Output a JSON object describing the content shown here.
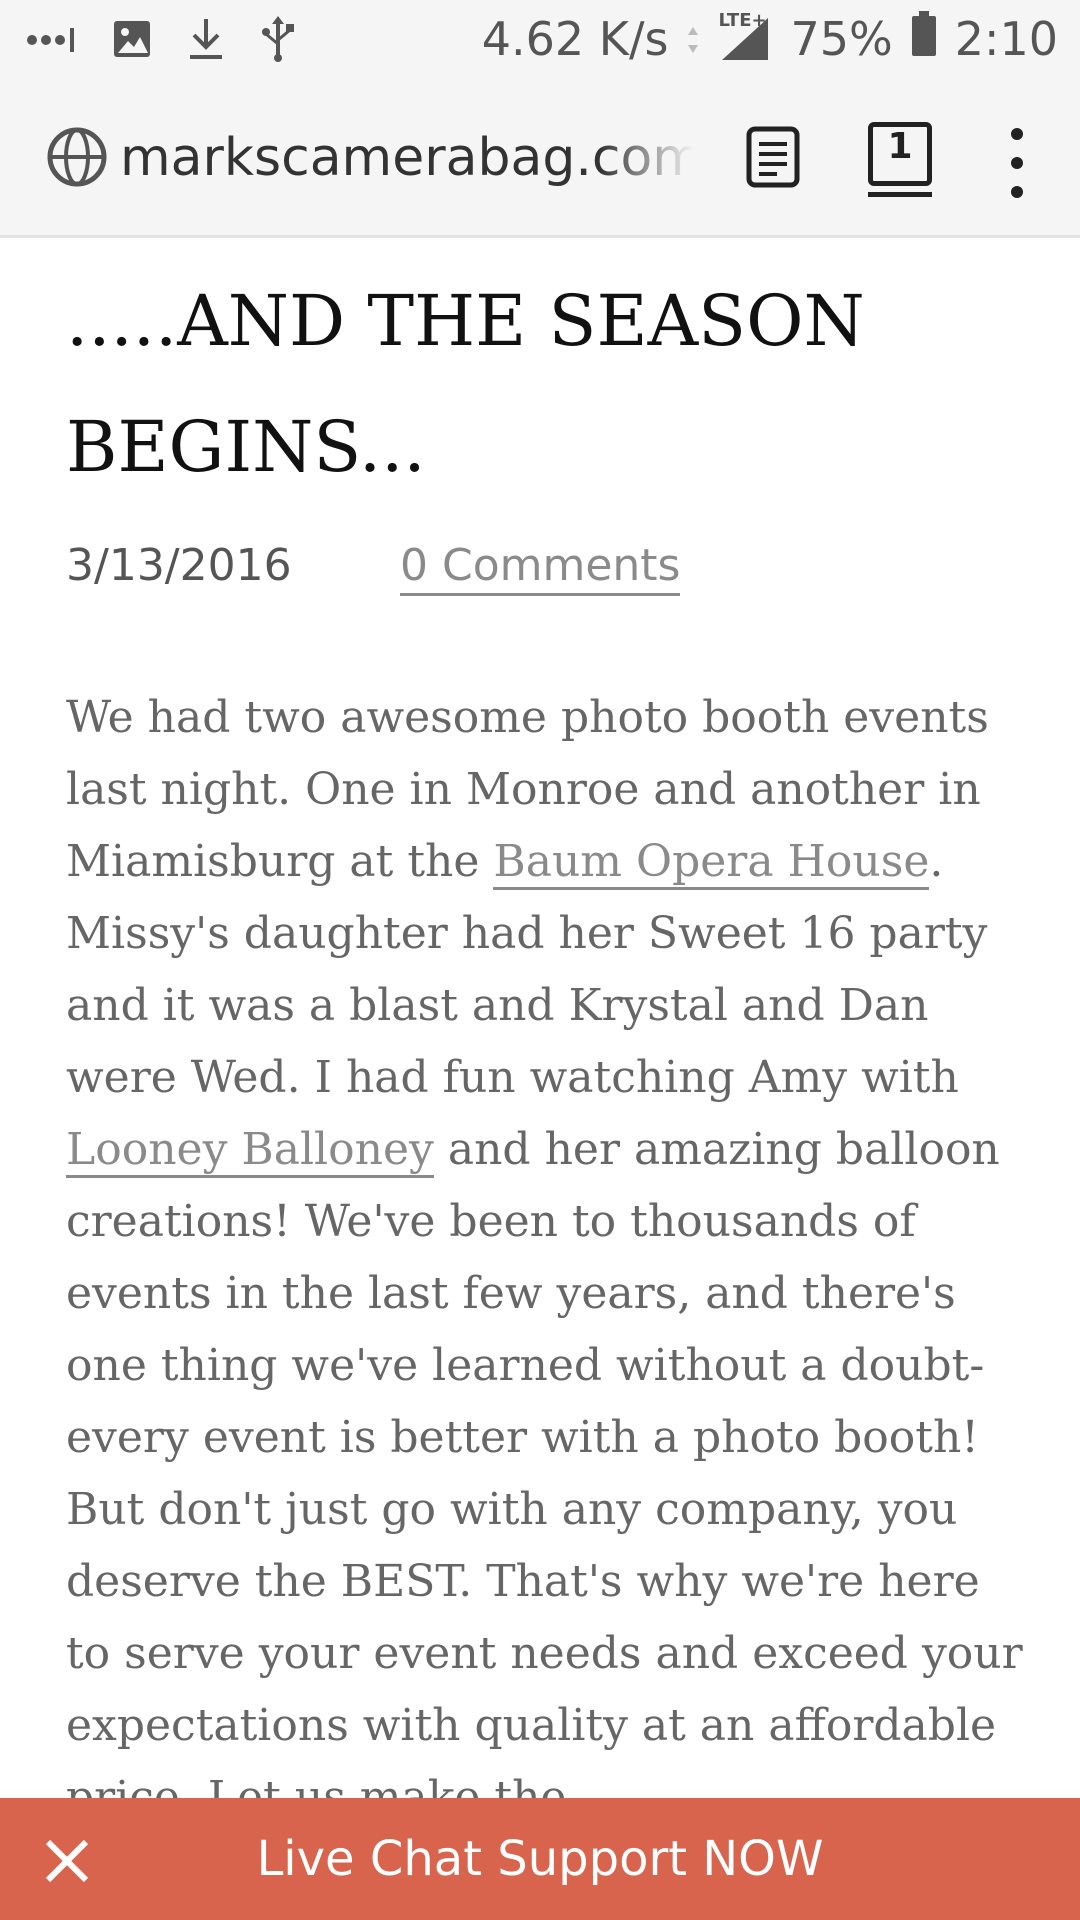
{
  "status_bar": {
    "icons": [
      "signal-dots-icon",
      "image-icon",
      "download-icon",
      "usb-icon"
    ],
    "net_speed": "4.62 K/s",
    "network": "LTE+",
    "battery": "75%",
    "time": "2:10"
  },
  "browser": {
    "url": "markscamerabag.com/b",
    "tab_count": "1",
    "icons": [
      "globe-icon",
      "reader-mode-icon",
      "tab-switcher-icon",
      "overflow-menu-icon"
    ]
  },
  "article": {
    "title_line1": ".....AND THE SEASON",
    "title_line2": "BEGINS...",
    "date": "3/13/2016",
    "comments_link": "0 Comments",
    "para_1": "We had two awesome photo booth events last night. One in Monroe and another in Miamisburg at the",
    "link_1": "Baum Opera House",
    "para_2": ". Missy's daughter had her Sweet 16 party and it was a blast and Krystal and Dan were Wed. I had fun watching Amy with",
    "link_2": "Looney Balloney",
    "para_3": "and her amazing balloon creations! We've been to thousands of events in the last few years, and there's one thing we've learned without a doubt- every event is better with a photo booth! But don't just go with any company, you deserve the BEST. That's why we're here to serve your event needs and exceed your expectations with quality at an affordable price. Let us make the"
  },
  "chat_bar": {
    "label": "Live Chat Support NOW",
    "background": "#d9644e"
  }
}
